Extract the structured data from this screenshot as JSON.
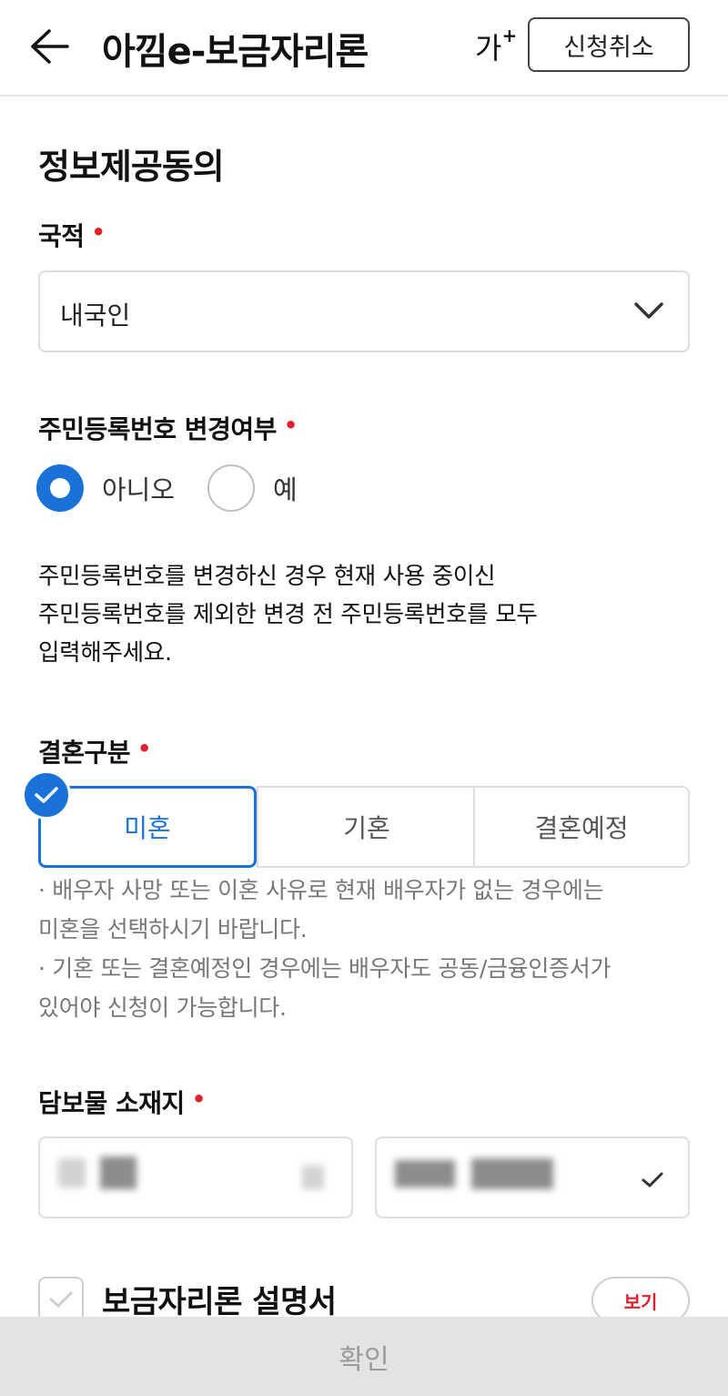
{
  "header": {
    "title": "아낌e-보금자리론",
    "font_size_label": "가",
    "font_size_plus": "+",
    "cancel_label": "신청취소"
  },
  "section": {
    "title": "정보제공동의"
  },
  "required_mark": "•",
  "nationality": {
    "label": "국적",
    "value": "내국인"
  },
  "resident_id_change": {
    "label": "주민등록번호 변경여부",
    "options": [
      "아니오",
      "예"
    ],
    "selected": "아니오",
    "description_lines": [
      "주민등록번호를 변경하신 경우 현재 사용 중이신",
      "주민등록번호를 제외한 변경 전 주민등록번호를 모두",
      "입력해주세요."
    ]
  },
  "marriage": {
    "label": "결혼구분",
    "options": [
      "미혼",
      "기혼",
      "결혼예정"
    ],
    "selected": "미혼",
    "notes": [
      "· 배우자 사망 또는 이혼 사유로 현재 배우자가 없는 경우에는",
      "미혼을 선택하시기 바랍니다.",
      "· 기혼 또는 결혼예정인 경우에는 배우자도 공동/금융인증서가",
      "있어야 신청이 가능합니다."
    ]
  },
  "collateral": {
    "label": "담보물 소재지"
  },
  "explanation": {
    "label": "보금자리론 설명서",
    "view_label": "보기"
  },
  "confirm_label": "확인",
  "colors": {
    "accent": "#1a72d8",
    "required": "#e0212b",
    "disabled_bg": "#e3e3e3"
  }
}
